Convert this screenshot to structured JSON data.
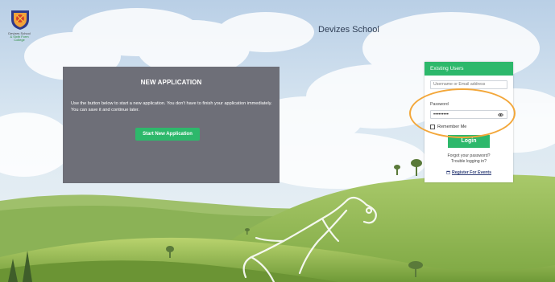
{
  "school": {
    "name": "Devizes School",
    "logo_line1": "Devizes School",
    "logo_line2": "& Sixth Form College"
  },
  "new_application": {
    "title": "NEW APPLICATION",
    "description": "Use the button below to start a new application. You don't have to finish your application immediately. You can save it and continue later.",
    "button_label": "Start New Application"
  },
  "login": {
    "header": "Existing Users",
    "username_placeholder": "Username or Email address",
    "password_label": "Password",
    "password_value": "•••••••••",
    "remember_label": "Remember Me",
    "login_button": "Login",
    "forgot_password": "Forgot your password?",
    "trouble": "Trouble logging in?",
    "register_events": "Register For Events"
  },
  "icons": {
    "eye": "eye-icon",
    "calendar": "calendar-icon",
    "logo": "school-crest-icon"
  },
  "colors": {
    "accent_green": "#2db86b",
    "panel_gray": "#6e6f78",
    "highlight": "#f3a73a",
    "link_blue": "#2f3e78"
  }
}
